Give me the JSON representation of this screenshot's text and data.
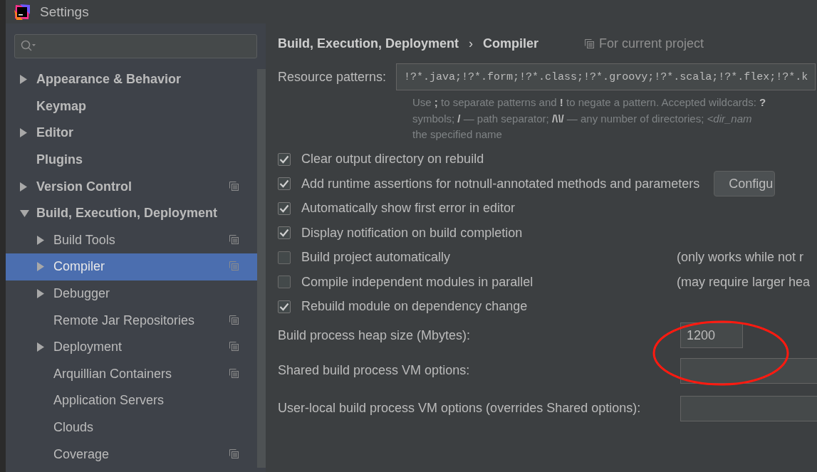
{
  "window": {
    "title": "Settings"
  },
  "tree": [
    {
      "label": "Appearance & Behavior",
      "kind": "folder",
      "expanded": false,
      "selected": false,
      "shared": false
    },
    {
      "label": "Keymap",
      "kind": "leaf",
      "selected": false,
      "shared": false
    },
    {
      "label": "Editor",
      "kind": "folder",
      "expanded": false,
      "selected": false,
      "shared": false
    },
    {
      "label": "Plugins",
      "kind": "leaf",
      "selected": false,
      "shared": false
    },
    {
      "label": "Version Control",
      "kind": "folder",
      "expanded": false,
      "selected": false,
      "shared": true
    },
    {
      "label": "Build, Execution, Deployment",
      "kind": "folder",
      "expanded": true,
      "selected": false,
      "shared": false,
      "children": [
        {
          "label": "Build Tools",
          "kind": "folder",
          "expanded": false,
          "selected": false,
          "shared": true
        },
        {
          "label": "Compiler",
          "kind": "folder",
          "expanded": false,
          "selected": true,
          "shared": true
        },
        {
          "label": "Debugger",
          "kind": "folder",
          "expanded": false,
          "selected": false,
          "shared": false
        },
        {
          "label": "Remote Jar Repositories",
          "kind": "leaf",
          "selected": false,
          "shared": true
        },
        {
          "label": "Deployment",
          "kind": "folder",
          "expanded": false,
          "selected": false,
          "shared": true
        },
        {
          "label": "Arquillian Containers",
          "kind": "leaf",
          "selected": false,
          "shared": true
        },
        {
          "label": "Application Servers",
          "kind": "leaf",
          "selected": false,
          "shared": false
        },
        {
          "label": "Clouds",
          "kind": "leaf",
          "selected": false,
          "shared": false
        },
        {
          "label": "Coverage",
          "kind": "leaf",
          "selected": false,
          "shared": true
        }
      ]
    }
  ],
  "breadcrumb": [
    "Build, Execution, Deployment",
    "›",
    "Compiler"
  ],
  "scope_note": "For current project",
  "resource_patterns": {
    "label": "Resource patterns:",
    "value": "!?*.java;!?*.form;!?*.class;!?*.groovy;!?*.scala;!?*.flex;!?*.k",
    "hint": [
      "Use **;** to separate patterns and **!** to negate a pattern. Accepted wildcards: **?**",
      "symbols; **/** — path separator; **/\\*\\*/** — any number of directories; *<dir_nam*",
      "the specified name"
    ]
  },
  "options": [
    {
      "label": "Clear output directory on rebuild",
      "checked": true
    },
    {
      "label": "Add runtime assertions for notnull-annotated methods and parameters",
      "checked": true,
      "button": "Configu"
    },
    {
      "label": "Automatically show first error in editor",
      "checked": true
    },
    {
      "label": "Display notification on build completion",
      "checked": true
    },
    {
      "label": "Build project automatically",
      "checked": false,
      "note": "(only works while not r"
    },
    {
      "label": "Compile independent modules in parallel",
      "checked": false,
      "note": "(may require larger hea"
    },
    {
      "label": "Rebuild module on dependency change",
      "checked": true
    }
  ],
  "fields": [
    {
      "label": "Build process heap size (Mbytes):",
      "value": "1200",
      "kind": "short"
    },
    {
      "label": "Shared build process VM options:",
      "kind": "wide"
    },
    {
      "label": "User-local build process VM options (overrides Shared options):",
      "kind": "wide"
    }
  ]
}
